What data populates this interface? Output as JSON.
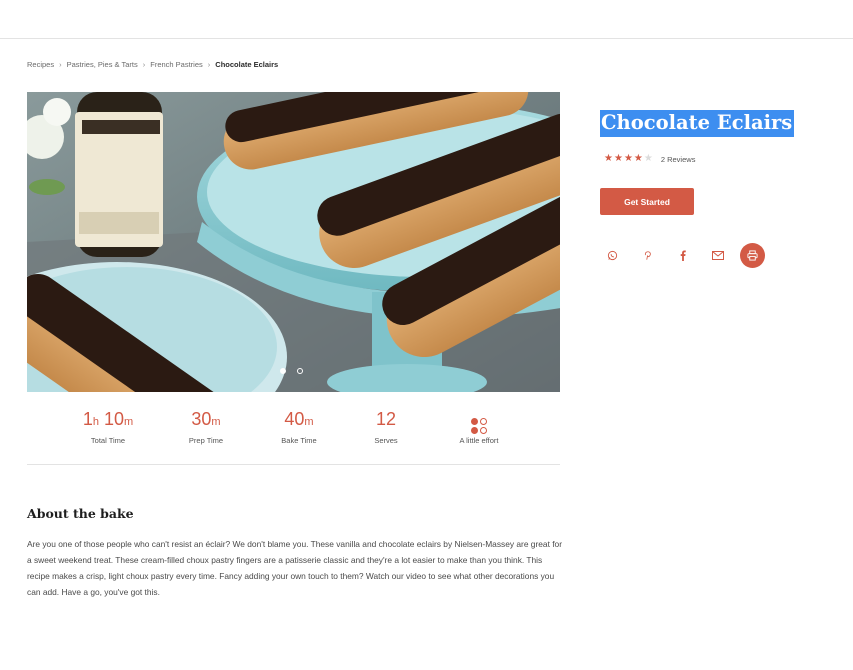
{
  "breadcrumb": [
    {
      "label": "Recipes"
    },
    {
      "label": "Pastries, Pies & Tarts"
    },
    {
      "label": "French Pastries"
    },
    {
      "label": "Chocolate Eclairs"
    }
  ],
  "breadcrumb_separator": "›",
  "carousel": {
    "slide_count": 2,
    "active_index": 0
  },
  "stats": {
    "total_time": {
      "hours": "1",
      "hours_unit": "h",
      "minutes": "10",
      "minutes_unit": "m",
      "label": "Total Time"
    },
    "prep_time": {
      "value": "30",
      "unit": "m",
      "label": "Prep Time"
    },
    "bake_time": {
      "value": "40",
      "unit": "m",
      "label": "Bake Time"
    },
    "serves": {
      "value": "12",
      "label": "Serves"
    },
    "effort": {
      "label": "A little effort",
      "level_filled": 2,
      "level_total": 4
    }
  },
  "about": {
    "title": "About the bake",
    "text": "Are you one of those people who can't resist an éclair? We don't blame you. These vanilla and chocolate eclairs by Nielsen-Massey are great for a sweet weekend treat. These cream-filled choux pastry fingers are a patisserie classic and they're a lot easier to make than you think. This recipe makes a crisp, light choux pastry every time. Fancy adding your own touch to them? Watch our video to see what other decorations you can add. Have a go, you've got this."
  },
  "recipe": {
    "title": "Chocolate Eclairs",
    "rating": 4,
    "rating_max": 5,
    "reviews_label": "2 Reviews"
  },
  "cta": {
    "label": "Get Started"
  },
  "share_icons": [
    "whatsapp-icon",
    "pinterest-icon",
    "facebook-icon",
    "email-icon",
    "print-icon"
  ],
  "colors": {
    "accent": "#d35a45",
    "selection": "#3d8ef0",
    "text": "#2b2b2b"
  }
}
